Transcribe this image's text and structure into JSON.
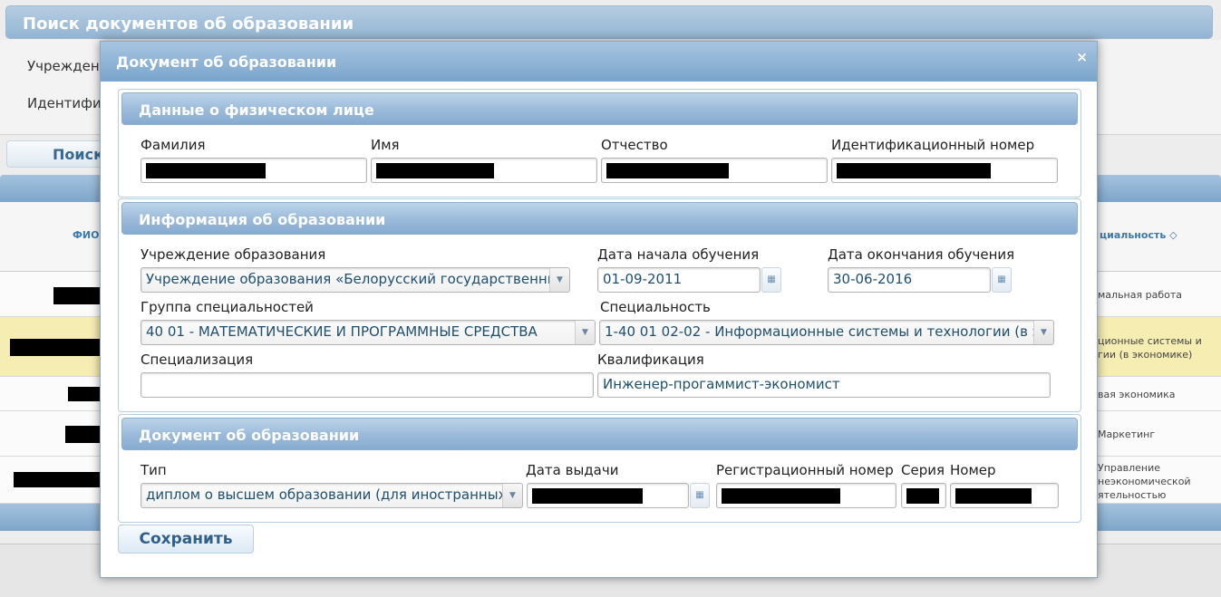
{
  "background": {
    "header_title": "Поиск документов об образовании",
    "label_institution": "Учреждени",
    "label_id": "Идентифи",
    "search_button": "Поиск",
    "col_fio": "ФИО",
    "col_spec": "циальность",
    "sort_icon": "sort-icon",
    "rows": [
      {
        "text": "мальная работа"
      },
      {
        "text": "ционные системы и\nгии (в экономике)"
      },
      {
        "text": "вая экономика"
      },
      {
        "text": "Маркетинг"
      },
      {
        "text": "Управление\nнеэкономической\nятельностью"
      }
    ]
  },
  "modal": {
    "title": "Документ об образовании",
    "close_symbol": "×",
    "person": {
      "section_title": "Данные о физическом лице",
      "surname_label": "Фамилия",
      "name_label": "Имя",
      "patronymic_label": "Отчество",
      "id_label": "Идентификационный номер"
    },
    "education": {
      "section_title": "Информация об образовании",
      "institution_label": "Учреждение образования",
      "institution_value": "Учреждение образования «Белорусский государственный",
      "start_label": "Дата начала обучения",
      "start_value": "01-09-2011",
      "end_label": "Дата окончания обучения",
      "end_value": "30-06-2016",
      "group_label": "Группа специальностей",
      "group_value": "40 01 - МАТЕМАТИЧЕСКИЕ И ПРОГРАММНЫЕ СРЕДСТВА",
      "specialty_label": "Специальность",
      "specialty_value": "1-40 01 02-02 - Информационные системы и технологии (в эк",
      "specialization_label": "Специализация",
      "specialization_value": "",
      "qualification_label": "Квалификация",
      "qualification_value": "Инженер-прогаммист-экономист"
    },
    "document": {
      "section_title": "Документ об образовании",
      "type_label": "Тип",
      "type_value": "диплом о высшем образовании (для иностранных гр",
      "issue_date_label": "Дата выдачи",
      "reg_number_label": "Регистрационный номер",
      "series_label": "Серия",
      "number_label": "Номер"
    },
    "save_button": "Сохранить"
  },
  "icons": {
    "dropdown": "▼",
    "calendar": "▦"
  }
}
